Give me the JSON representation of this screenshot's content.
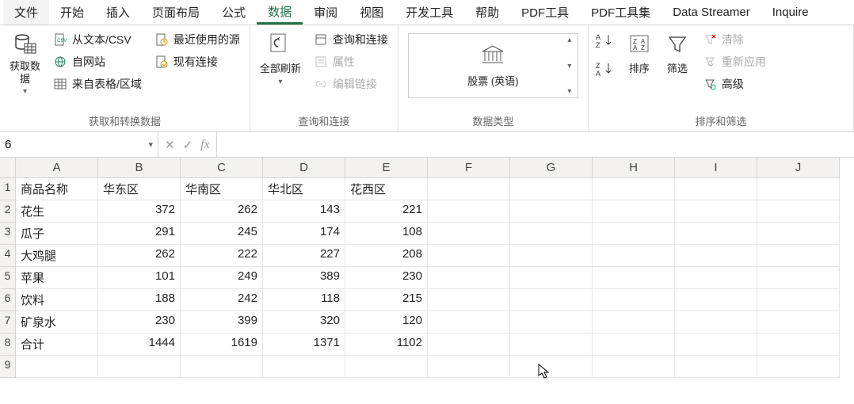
{
  "menu": {
    "items": [
      "文件",
      "开始",
      "插入",
      "页面布局",
      "公式",
      "数据",
      "审阅",
      "视图",
      "开发工具",
      "帮助",
      "PDF工具",
      "PDF工具集",
      "Data Streamer",
      "Inquire"
    ],
    "active_index": 5
  },
  "ribbon": {
    "group1": {
      "get_data": "获取数\n据",
      "from_text": "从文本/CSV",
      "from_web": "自网站",
      "from_table": "来自表格/区域",
      "recent": "最近使用的源",
      "existing": "现有连接",
      "label": "获取和转换数据"
    },
    "group2": {
      "refresh_all": "全部刷新",
      "queries": "查询和连接",
      "properties": "属性",
      "edit_links": "编辑链接",
      "label": "查询和连接"
    },
    "group3": {
      "stocks": "股票 (英语)",
      "label": "数据类型"
    },
    "group4": {
      "sort": "排序",
      "filter": "筛选",
      "clear": "清除",
      "reapply": "重新应用",
      "advanced": "高级",
      "label": "排序和筛选"
    }
  },
  "formula_bar": {
    "name_box": "6",
    "formula": ""
  },
  "sheet": {
    "columns": [
      "A",
      "B",
      "C",
      "D",
      "E",
      "F",
      "G",
      "H",
      "I",
      "J"
    ],
    "rows": [
      {
        "n": "1",
        "cells": [
          "商品名称",
          "华东区",
          "华南区",
          "华北区",
          "花西区",
          "",
          "",
          "",
          "",
          ""
        ]
      },
      {
        "n": "2",
        "cells": [
          "花生",
          "372",
          "262",
          "143",
          "221",
          "",
          "",
          "",
          "",
          ""
        ]
      },
      {
        "n": "3",
        "cells": [
          "瓜子",
          "291",
          "245",
          "174",
          "108",
          "",
          "",
          "",
          "",
          ""
        ]
      },
      {
        "n": "4",
        "cells": [
          "大鸡腿",
          "262",
          "222",
          "227",
          "208",
          "",
          "",
          "",
          "",
          ""
        ]
      },
      {
        "n": "5",
        "cells": [
          "苹果",
          "101",
          "249",
          "389",
          "230",
          "",
          "",
          "",
          "",
          ""
        ]
      },
      {
        "n": "6",
        "cells": [
          "饮料",
          "188",
          "242",
          "118",
          "215",
          "",
          "",
          "",
          "",
          ""
        ]
      },
      {
        "n": "7",
        "cells": [
          "矿泉水",
          "230",
          "399",
          "320",
          "120",
          "",
          "",
          "",
          "",
          ""
        ]
      },
      {
        "n": "8",
        "cells": [
          "合计",
          "1444",
          "1619",
          "1371",
          "1102",
          "",
          "",
          "",
          "",
          ""
        ]
      },
      {
        "n": "9",
        "cells": [
          "",
          "",
          "",
          "",
          "",
          "",
          "",
          "",
          "",
          ""
        ]
      }
    ]
  },
  "chart_data": {
    "type": "table",
    "title": "",
    "columns": [
      "商品名称",
      "华东区",
      "华南区",
      "华北区",
      "花西区"
    ],
    "rows": [
      [
        "花生",
        372,
        262,
        143,
        221
      ],
      [
        "瓜子",
        291,
        245,
        174,
        108
      ],
      [
        "大鸡腿",
        262,
        222,
        227,
        208
      ],
      [
        "苹果",
        101,
        249,
        389,
        230
      ],
      [
        "饮料",
        188,
        242,
        118,
        215
      ],
      [
        "矿泉水",
        230,
        399,
        320,
        120
      ],
      [
        "合计",
        1444,
        1619,
        1371,
        1102
      ]
    ]
  }
}
